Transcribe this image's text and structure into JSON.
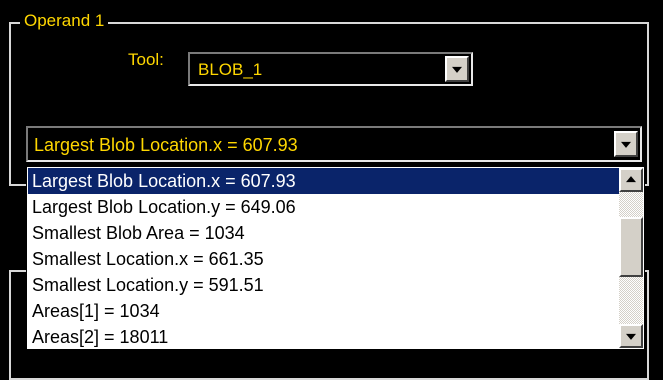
{
  "group": {
    "title": "Operand 1"
  },
  "tool": {
    "label": "Tool:",
    "value": "BLOB_1"
  },
  "result": {
    "value": "Largest Blob Location.x = 607.93"
  },
  "dropdown": {
    "items": [
      {
        "label": "Largest Blob Location.x = 607.93",
        "selected": true
      },
      {
        "label": "Largest Blob Location.y = 649.06"
      },
      {
        "label": "Smallest Blob Area = 1034"
      },
      {
        "label": "Smallest Location.x = 661.35"
      },
      {
        "label": "Smallest Location.y = 591.51"
      },
      {
        "label": "Areas[1] = 1034"
      },
      {
        "label": "Areas[2] = 18011"
      }
    ],
    "scroll_position": 0.35
  },
  "colors": {
    "accent_text": "#ffd700",
    "selection": "#0a246a",
    "background": "#000000"
  }
}
